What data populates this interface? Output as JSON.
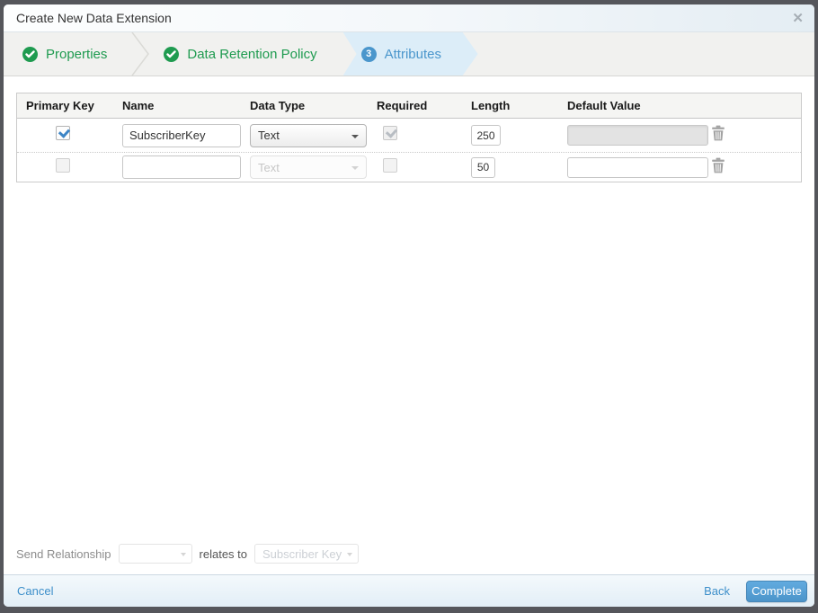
{
  "window": {
    "title": "Create New Data Extension",
    "close_glyph": "✕"
  },
  "wizard": {
    "steps": [
      {
        "label": "Properties",
        "state": "complete"
      },
      {
        "label": "Data Retention Policy",
        "state": "complete"
      },
      {
        "label": "Attributes",
        "state": "active",
        "number": "3"
      }
    ]
  },
  "table": {
    "headers": [
      "Primary Key",
      "Name",
      "Data Type",
      "Required",
      "Length",
      "Default Value"
    ],
    "rows": [
      {
        "primary_key_checked": true,
        "name": "SubscriberKey",
        "data_type": "Text",
        "data_type_disabled": false,
        "required_checked": true,
        "required_disabled": true,
        "length": "250",
        "default_value": "",
        "default_disabled": true
      },
      {
        "primary_key_checked": false,
        "name": "",
        "data_type": "Text",
        "data_type_disabled": true,
        "required_checked": false,
        "required_disabled": false,
        "length": "50",
        "default_value": "",
        "default_disabled": false
      }
    ]
  },
  "send_relationship": {
    "label": "Send Relationship",
    "relates_to": "relates to",
    "target": "Subscriber Key"
  },
  "footer": {
    "cancel": "Cancel",
    "back": "Back",
    "complete": "Complete"
  },
  "colors": {
    "accent_green": "#1f9b50",
    "accent_blue": "#4a96cc",
    "button_blue": "#4c95ca",
    "active_step_bg": "#dcedf8"
  }
}
